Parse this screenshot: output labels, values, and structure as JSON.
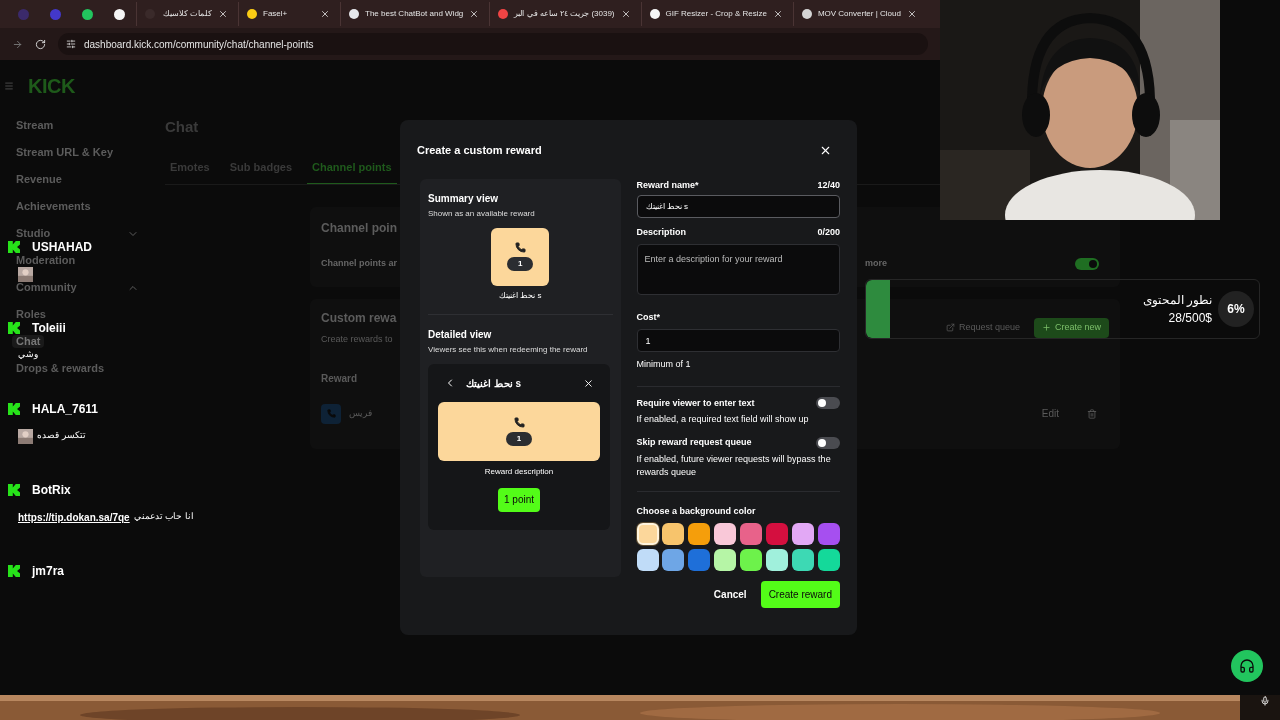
{
  "browser": {
    "tabs": [
      {
        "kind": "icon",
        "color": "#3b2a6b"
      },
      {
        "kind": "icon",
        "color": "#4338ca"
      },
      {
        "kind": "icon",
        "color": "#22c55e"
      },
      {
        "kind": "icon",
        "color": "#f5f5f5"
      },
      {
        "kind": "titled",
        "title": "كلمات كلاسيك",
        "color": "#3a2a2a"
      },
      {
        "kind": "titled",
        "title": "Fasel+",
        "color": "#facc15"
      },
      {
        "kind": "titled",
        "title": "The best ChatBot and Widg",
        "color": "#e5e7eb"
      },
      {
        "kind": "titled",
        "title": "(3039) جريت ٢٤ ساعه في البر",
        "color": "#ef4444"
      },
      {
        "kind": "titled",
        "title": "GIF Resizer - Crop & Resize",
        "color": "#f5f5f5"
      },
      {
        "kind": "titled",
        "title": "MOV Converter | Cloud",
        "color": "#d4d4d4"
      }
    ],
    "url": "dashboard.kick.com/community/chat/channel-points"
  },
  "sidebar": {
    "logo": "KICK",
    "items": [
      {
        "label": "Stream",
        "kind": "link",
        "selected": false
      },
      {
        "label": "Stream URL & Key",
        "kind": "link",
        "selected": false
      },
      {
        "label": "Revenue",
        "kind": "link",
        "selected": false
      },
      {
        "label": "Achievements",
        "kind": "link",
        "selected": false
      },
      {
        "label": "Studio",
        "kind": "group",
        "expanded": false,
        "selected": false
      },
      {
        "label": "Moderation",
        "kind": "link",
        "selected": false
      },
      {
        "label": "Community",
        "kind": "group",
        "expanded": true,
        "selected": false
      },
      {
        "label": "Roles",
        "kind": "link",
        "selected": false
      },
      {
        "label": "Chat",
        "kind": "link",
        "selected": true
      },
      {
        "label": "Drops & rewards",
        "kind": "link",
        "selected": false
      }
    ]
  },
  "page": {
    "title": "Chat",
    "tabs": [
      {
        "label": "Emotes",
        "selected": false
      },
      {
        "label": "Sub badges",
        "selected": false
      },
      {
        "label": "Channel points",
        "selected": true
      }
    ],
    "channel_points_card": {
      "title": "Channel poin",
      "text_left": "Channel points ar",
      "text_right": "more",
      "enabled": true
    },
    "custom_rewards_card": {
      "title": "Custom rewa",
      "subtitle": "Create rewards to",
      "buttons": [
        "Request queue",
        "Create new"
      ],
      "column": "Reward",
      "rows": [
        {
          "name": "فريس",
          "action": "Edit"
        }
      ]
    }
  },
  "modal": {
    "title": "Create a custom reward",
    "summary": {
      "title": "Summary view",
      "subtitle": "Shown as an available reward",
      "cost": "1",
      "name": "نحط اغنيتك s"
    },
    "detail": {
      "title": "Detailed view",
      "subtitle": "Viewers see this when redeeming the reward",
      "name": "نحط اغنيتك s",
      "cost": "1",
      "description": "Reward description",
      "button": "1 point"
    },
    "fields": {
      "name_label": "Reward name*",
      "name_count": "12/40",
      "name_value": "نحط اغنيتك s",
      "description_label": "Description",
      "description_count": "0/200",
      "description_placeholder": "Enter a description for your reward",
      "cost_label": "Cost*",
      "cost_value": "1",
      "cost_hint": "Minimum of 1"
    },
    "toggles": [
      {
        "label": "Require viewer to enter text",
        "hint": "If enabled, a required text field will show up",
        "on": false
      },
      {
        "label": "Skip reward request queue",
        "hint": "If enabled, future viewer requests will bypass the rewards queue",
        "on": false
      }
    ],
    "color_label": "Choose a background color",
    "colors": [
      {
        "color": "#fcd79b",
        "selected": true
      },
      {
        "color": "#f7c46c",
        "selected": false
      },
      {
        "color": "#f59e0b",
        "selected": false
      },
      {
        "color": "#f9c8d8",
        "selected": false
      },
      {
        "color": "#e8628a",
        "selected": false
      },
      {
        "color": "#d40f3f",
        "selected": false
      },
      {
        "color": "#e2a8f5",
        "selected": false
      },
      {
        "color": "#a64ff0",
        "selected": false
      },
      {
        "color": "#c0dcf8",
        "selected": false
      },
      {
        "color": "#6ea6e6",
        "selected": false
      },
      {
        "color": "#1e6fd9",
        "selected": false
      },
      {
        "color": "#b6f5a6",
        "selected": false
      },
      {
        "color": "#6df24b",
        "selected": false
      },
      {
        "color": "#a0f0dc",
        "selected": false
      },
      {
        "color": "#3dd9b4",
        "selected": false
      },
      {
        "color": "#14d99a",
        "selected": false
      }
    ],
    "buttons": [
      "Cancel",
      "Create reward"
    ]
  },
  "chat_overlay": [
    {
      "username": "USHAHAD",
      "message": [
        {
          "kind": "picture"
        }
      ]
    },
    {
      "username": "Toleiii",
      "message": [
        {
          "kind": "text",
          "text": "وشي"
        }
      ]
    },
    {
      "username": "HALA_7611",
      "message": [
        {
          "kind": "picture"
        },
        {
          "kind": "text",
          "text": "تتكسر قصده"
        }
      ]
    },
    {
      "username": "BotRix",
      "message": [
        {
          "kind": "link",
          "text": "https://tip.dokan.sa/7qe"
        },
        {
          "kind": "text",
          "text": "انا حاب تدعمني"
        }
      ]
    },
    {
      "username": "jm7ra"
    }
  ],
  "donation_goal": {
    "title": "نطور المحتوى",
    "amount": "28/500$",
    "percent": "6%",
    "level": 0.06
  }
}
